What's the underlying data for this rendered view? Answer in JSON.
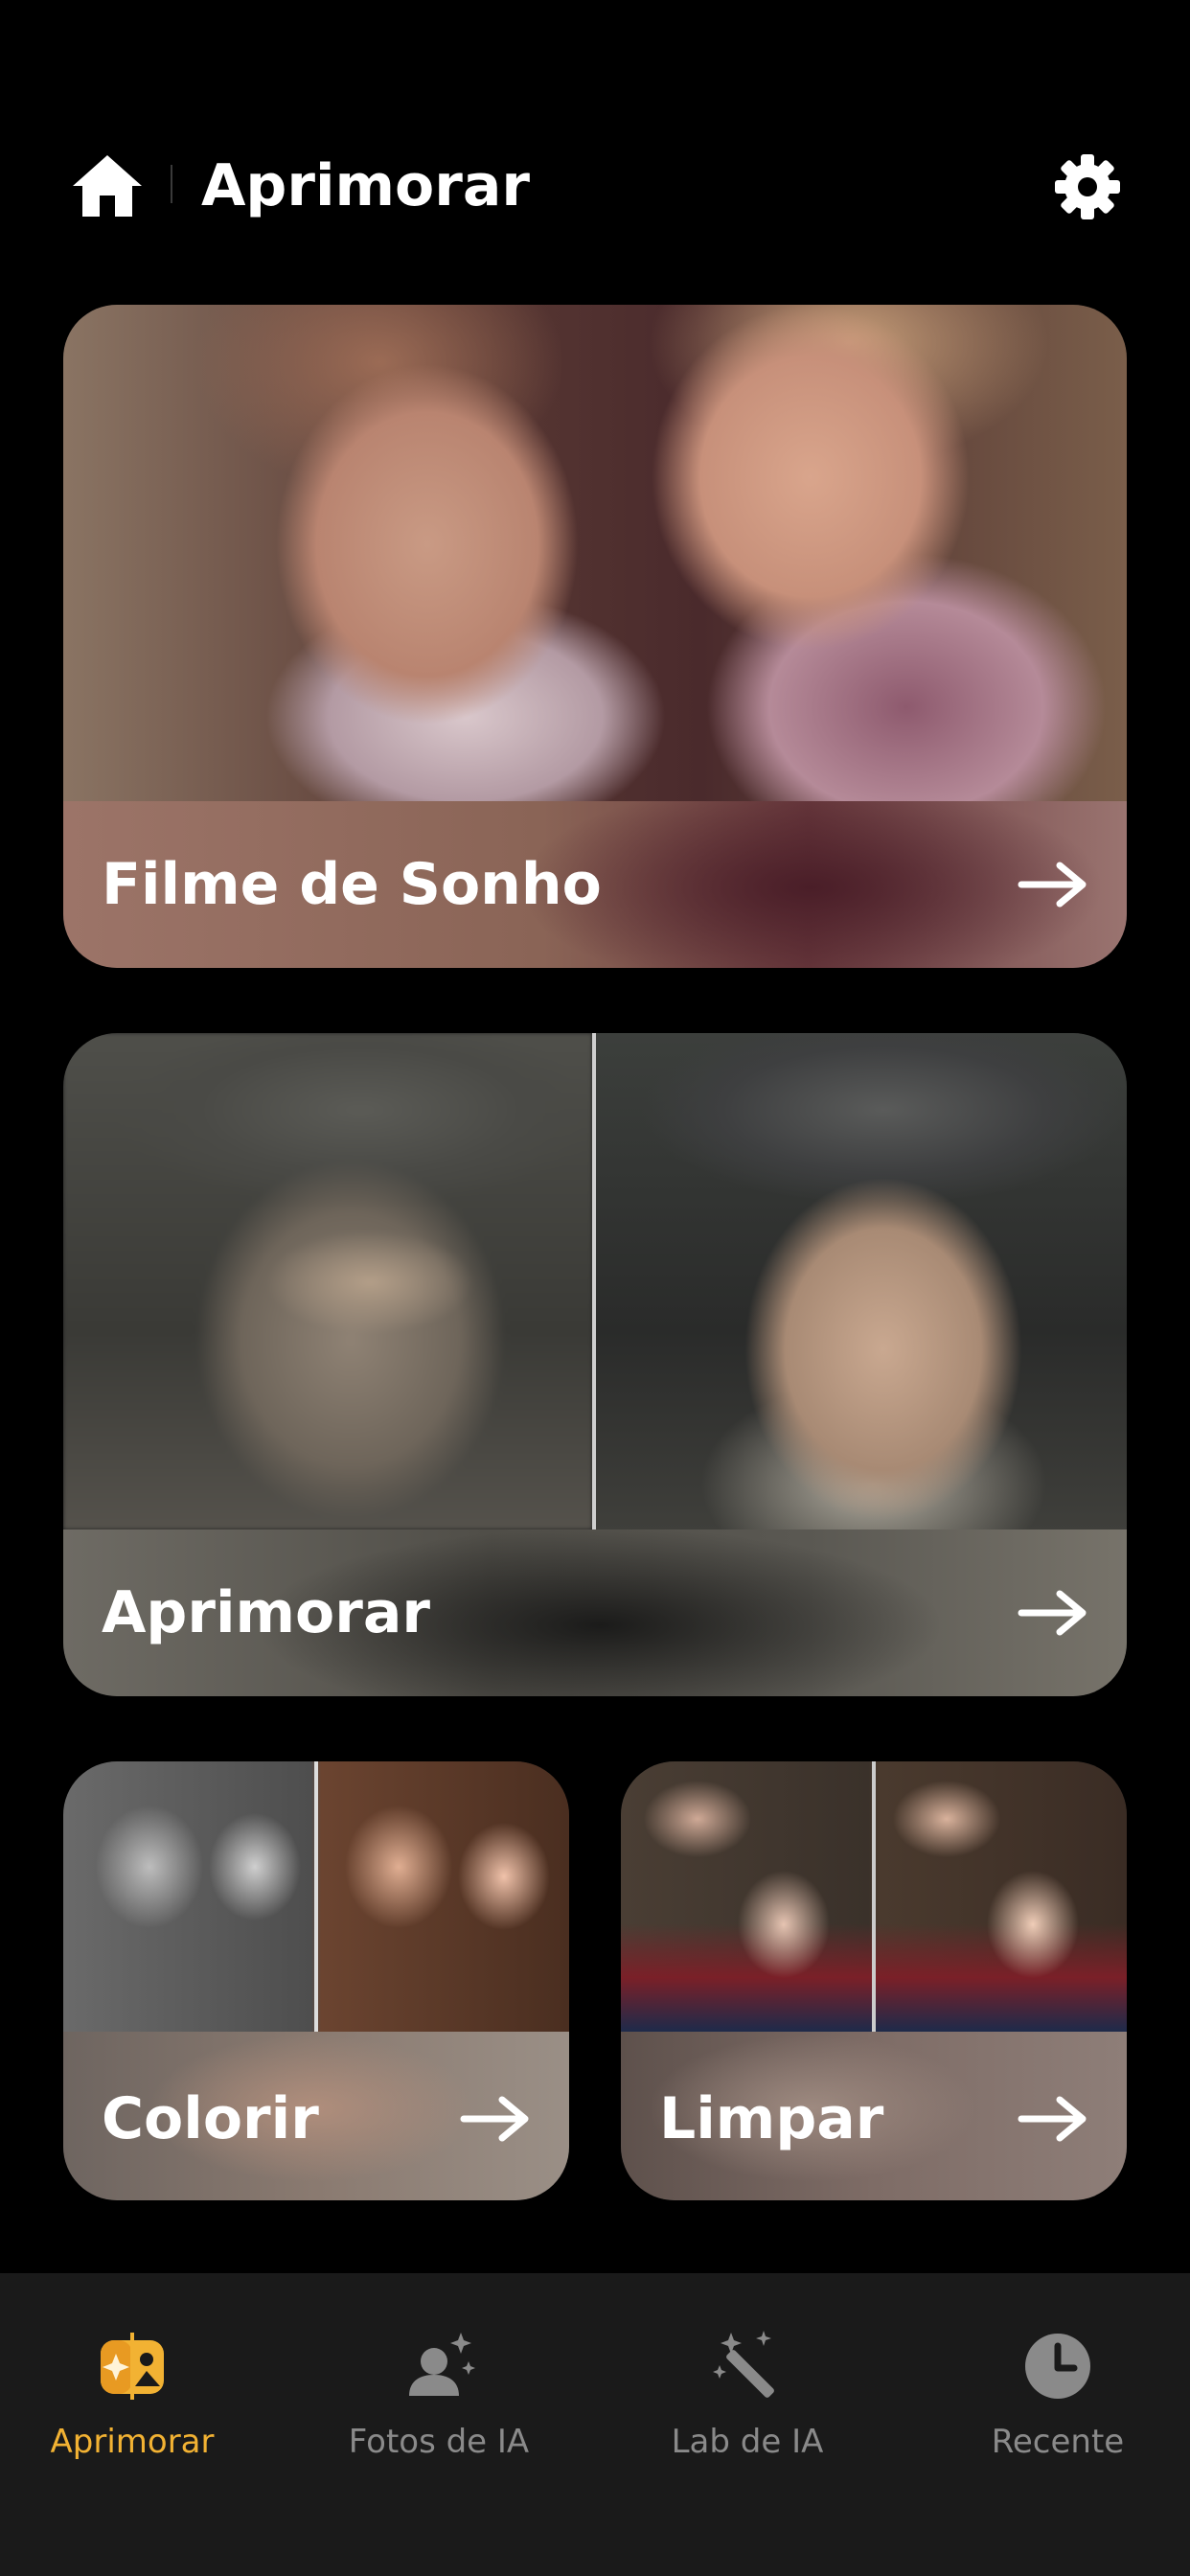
{
  "header": {
    "title": "Aprimorar",
    "home_icon": "home-icon",
    "settings_icon": "gear-icon"
  },
  "cards": [
    {
      "label": "Filme de Sonho",
      "arrow_icon": "arrow-right-icon"
    },
    {
      "label": "Aprimorar",
      "arrow_icon": "arrow-right-icon"
    },
    {
      "label": "Colorir",
      "arrow_icon": "arrow-right-icon"
    },
    {
      "label": "Limpar",
      "arrow_icon": "arrow-right-icon"
    }
  ],
  "bottom_nav": {
    "items": [
      {
        "label": "Aprimorar",
        "icon": "enhance-photo-icon",
        "active": true
      },
      {
        "label": "Fotos de IA",
        "icon": "ai-person-sparkle-icon",
        "active": false
      },
      {
        "label": "Lab de IA",
        "icon": "magic-wand-icon",
        "active": false
      },
      {
        "label": "Recente",
        "icon": "clock-icon",
        "active": false
      }
    ]
  },
  "colors": {
    "background": "#000000",
    "nav_background": "#1a1a1a",
    "accent": "#f2b233",
    "inactive": "#8a8a8a"
  }
}
